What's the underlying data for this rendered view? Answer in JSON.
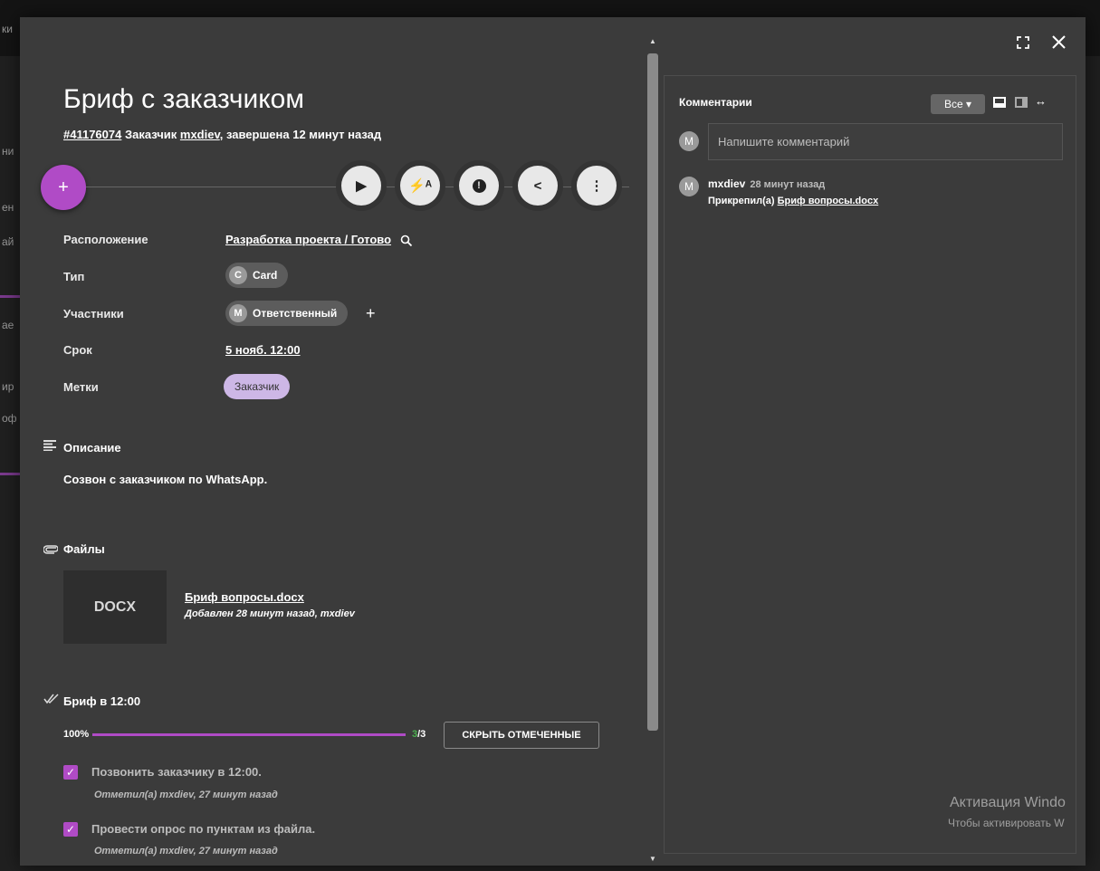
{
  "card": {
    "title": "Бриф с заказчиком",
    "id": "#41176074",
    "subtitle_prefix": "Заказчик",
    "author": "mxdiev",
    "subtitle_suffix": ", завершена 12 минут назад"
  },
  "actions": {
    "add": "+",
    "play": "▶",
    "flash": "⚡ᴬ",
    "alert": "!",
    "share": "<",
    "more": "⋮"
  },
  "fields": {
    "location_label": "Расположение",
    "location_value": "Разработка проекта / Готово",
    "type_label": "Тип",
    "type_letter": "C",
    "type_value": "Card",
    "members_label": "Участники",
    "member_letter": "M",
    "member_value": "Ответственный",
    "add_member": "+",
    "deadline_label": "Срок",
    "deadline_value": "5 нояб. 12:00",
    "tags_label": "Метки",
    "tag_value": "Заказчик"
  },
  "description": {
    "title": "Описание",
    "text": "Созвон с заказчиком по WhatsApp."
  },
  "files": {
    "title": "Файлы",
    "items": [
      {
        "ext": "DOCX",
        "name": "Бриф вопросы.docx",
        "meta": "Добавлен 28 минут назад, mxdiev"
      }
    ]
  },
  "checklist": {
    "title": "Бриф в 12:00",
    "percent_label": "100%",
    "progress": 1.0,
    "done": "3",
    "total": "/3",
    "hide_button": "СКРЫТЬ ОТМЕЧЕННЫЕ",
    "items": [
      {
        "text": "Позвонить заказчику в 12:00.",
        "meta": "Отметил(а) mxdiev, 27 минут назад"
      },
      {
        "text": "Провести опрос по пунктам из файла.",
        "meta": "Отметил(а) mxdiev, 27 минут назад"
      }
    ]
  },
  "comments": {
    "title": "Комментарии",
    "filter": "Все ▾",
    "avatar": "M",
    "placeholder": "Напишите комментарий",
    "items": [
      {
        "avatar": "M",
        "author": "mxdiev",
        "time": "28 минут назад",
        "text_prefix": "Прикрепил(а) ",
        "link": "Бриф вопросы.docx"
      }
    ]
  },
  "background": {
    "fragments": [
      "ки",
      "ни",
      "ен",
      "ай",
      "ае",
      "ир",
      "оф"
    ]
  },
  "watermark": {
    "line1": "Активация Windo",
    "line2": "Чтобы активировать W"
  },
  "colors": {
    "accent": "#b04bc6",
    "modal_bg": "#3b3b3b",
    "tag_bg": "#cdb7e6",
    "progress_done": "#4caf50"
  },
  "icons": {
    "search": "search-icon",
    "description": "notes-icon",
    "attachment": "paperclip-icon",
    "checklist": "double-check-icon",
    "fullscreen": "fullscreen-icon",
    "close": "close-icon"
  }
}
